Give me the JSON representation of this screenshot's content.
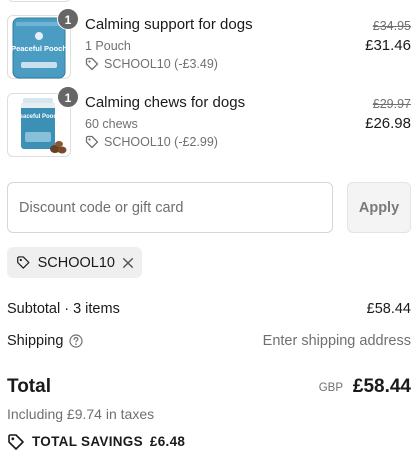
{
  "line_items": [
    {
      "quantity": "1",
      "title": "Calming support for dogs",
      "variant": "1 Pouch",
      "discount": "SCHOOL10 (-£3.49)",
      "original_price": "£34.95",
      "price": "£31.46",
      "product_label": "Peaceful Pooch"
    },
    {
      "quantity": "1",
      "title": "Calming chews for dogs",
      "variant": "60 chews",
      "discount": "SCHOOL10 (-£2.99)",
      "original_price": "£29.97",
      "price": "£26.98",
      "product_label": "Peaceful Pooch"
    }
  ],
  "discount_form": {
    "placeholder": "Discount code or gift card",
    "apply_label": "Apply"
  },
  "applied_code": "SCHOOL10",
  "summary": {
    "subtotal_label": "Subtotal · 3 items",
    "subtotal_value": "£58.44",
    "shipping_label": "Shipping",
    "shipping_value": "Enter shipping address",
    "total_label": "Total",
    "currency": "GBP",
    "total_value": "£58.44",
    "taxes_note": "Including £9.74 in taxes",
    "savings_label": "TOTAL SAVINGS",
    "savings_value": "£6.48"
  },
  "colors": {
    "badge": "#666666",
    "muted_text": "#707070",
    "pouch_teal": "#3c8fb5",
    "chip_bg": "#efefef"
  }
}
